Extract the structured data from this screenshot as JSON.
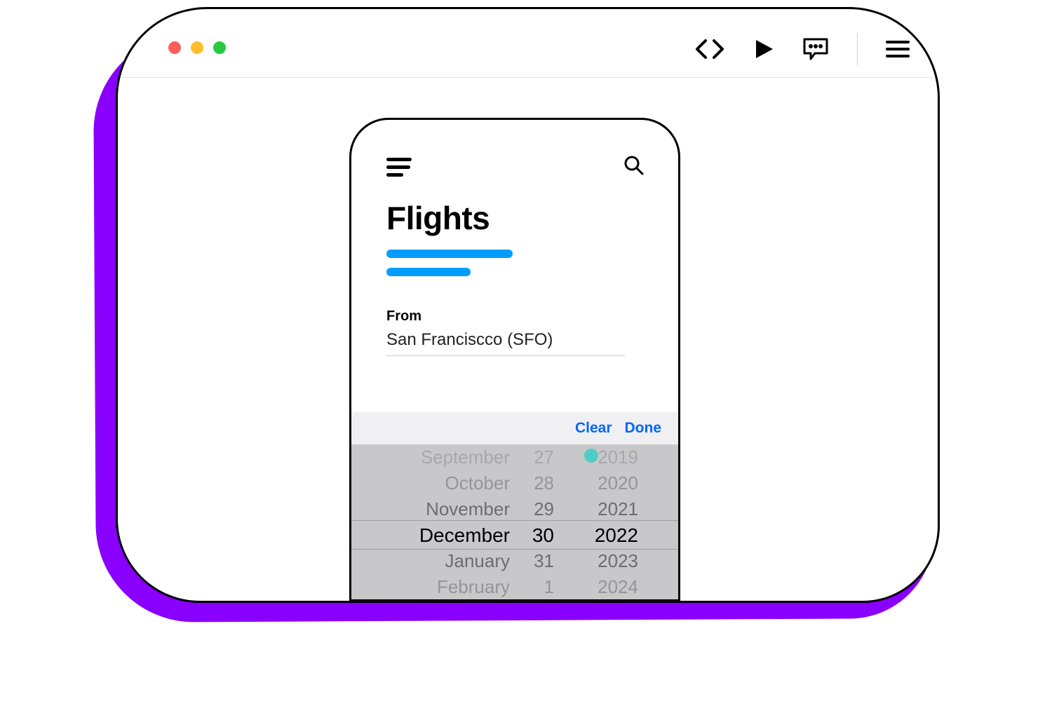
{
  "app": {
    "title": "Flights",
    "from_label": "From",
    "from_value": "San Franciscco  (SFO)"
  },
  "picker": {
    "clear": "Clear",
    "done": "Done",
    "months": [
      "September",
      "October",
      "November",
      "December",
      "January",
      "February"
    ],
    "days": [
      "27",
      "28",
      "29",
      "30",
      "31",
      "1"
    ],
    "years": [
      "2019",
      "2020",
      "2021",
      "2022",
      "2023",
      "2024"
    ],
    "selected_index": 3
  },
  "colors": {
    "accent_blue": "#009dff",
    "link_blue": "#0066ff",
    "purple": "#8a00ff"
  }
}
